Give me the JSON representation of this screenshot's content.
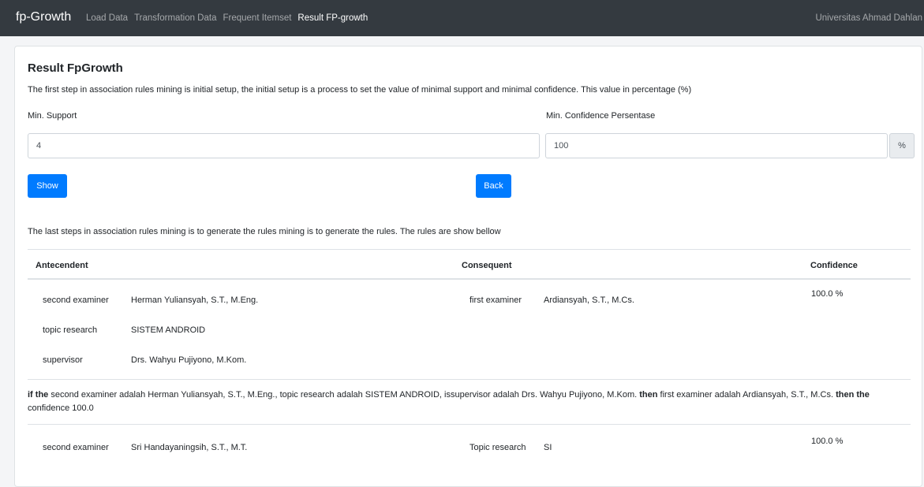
{
  "navbar": {
    "brand": "fp-Growth",
    "items": [
      "Load Data",
      "Transformation Data",
      "Frequent Itemset",
      "Result FP-growth"
    ],
    "right": "Universitas Ahmad Dahlan"
  },
  "page": {
    "title": "Result FpGrowth",
    "intro": "The first step in association rules mining is initial setup, the initial setup is a process to set the value of minimal support and minimal confidence. This value in percentage (%)",
    "min_support_label": "Min. Support",
    "min_confidence_label": "Min. Confidence Persentase",
    "min_support_value": "4",
    "min_confidence_value": "100",
    "percent_addon": "%",
    "show_button": "Show",
    "back_button": "Back",
    "rules_text": "The last steps in association rules mining is to generate the rules mining is to generate the rules. The rules are show bellow"
  },
  "table": {
    "headers": [
      "Antecendent",
      "Consequent",
      "Confidence"
    ],
    "rules": [
      {
        "antecedents": [
          {
            "key": "second examiner",
            "value": "Herman Yuliansyah, S.T., M.Eng."
          },
          {
            "key": "topic research",
            "value": "SISTEM ANDROID"
          },
          {
            "key": "supervisor",
            "value": "Drs. Wahyu Pujiyono, M.Kom."
          }
        ],
        "consequent": {
          "key": "first examiner",
          "value": "Ardiansyah, S.T., M.Cs."
        },
        "confidence": "100.0 %",
        "summary": {
          "if": "if the",
          "p1": " second examiner adalah Herman Yuliansyah, S.T., M.Eng., topic research adalah SISTEM ANDROID, issupervisor adalah Drs. Wahyu Pujiyono, M.Kom. ",
          "then1": "then",
          "p2": " first examiner adalah Ardiansyah, S.T., M.Cs. ",
          "then2": "then the",
          "p3": " confidence 100.0"
        }
      },
      {
        "antecedents": [
          {
            "key": "second examiner",
            "value": "Sri Handayaningsih, S.T., M.T."
          }
        ],
        "consequent": {
          "key": "Topic research",
          "value": "SI"
        },
        "confidence": "100.0 %"
      }
    ]
  }
}
